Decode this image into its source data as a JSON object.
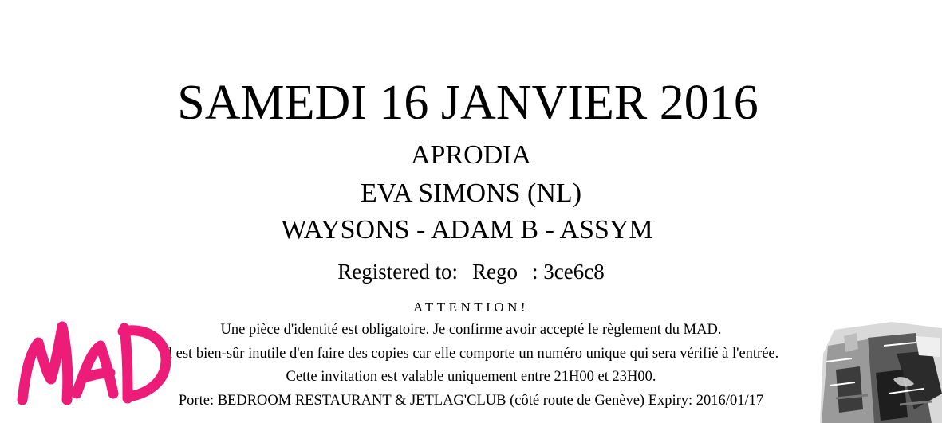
{
  "event": {
    "date": "SAMEDI 16 JANVIER 2016",
    "artists": [
      "APRODIA",
      "EVA SIMONS (NL)",
      "WAYSONS - ADAM B - ASSYM"
    ]
  },
  "registration": {
    "label": "Registered to:",
    "name": "Rego",
    "code": ": 3ce6c8"
  },
  "notice": {
    "heading": "ATTENTION!",
    "lines": [
      "Une pièce d'identité est obligatoire. Je confirme avoir accepté le règlement du MAD.",
      "Il est bien-sûr inutile d'en faire des copies car elle comporte un numéro unique qui sera vérifié à l'entrée.",
      "Cette invitation est valable uniquement entre 21H00 et 23H00.",
      "Porte: BEDROOM RESTAURANT & JETLAG'CLUB (côté route de Genève) Expiry: 2016/01/17"
    ]
  },
  "logo": {
    "text": "MAD",
    "color": "#ee1c79"
  }
}
